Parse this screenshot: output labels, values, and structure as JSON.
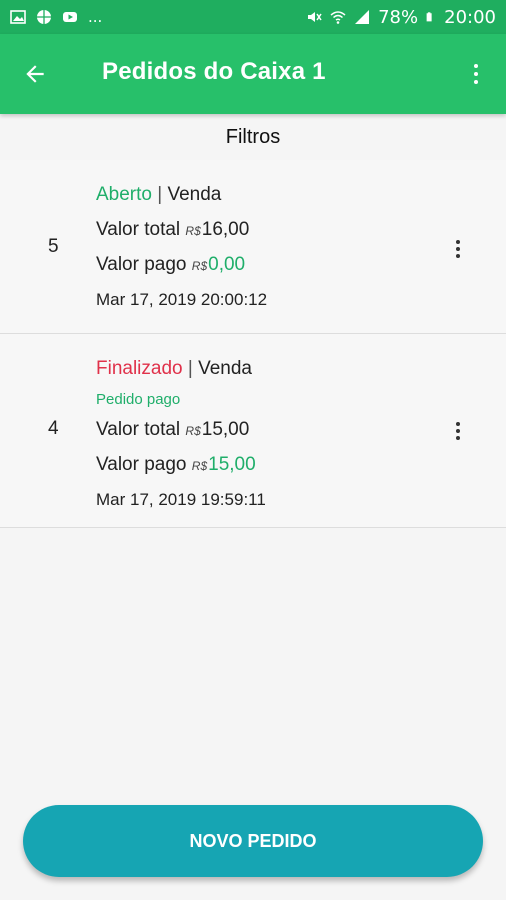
{
  "status_bar": {
    "left_text": "...",
    "battery": "78%",
    "time": "20:00",
    "icons": [
      "image-icon",
      "globe-icon",
      "youtube-icon",
      "mute-icon",
      "wifi-icon",
      "signal-icon",
      "battery-icon"
    ]
  },
  "app_bar": {
    "title": "Pedidos do Caixa 1",
    "color": "#27c06a"
  },
  "filters_label": "Filtros",
  "orders": [
    {
      "number": "5",
      "status": "Aberto",
      "separator": "|",
      "type": "Venda",
      "total_label": "Valor total",
      "currency": "R$",
      "total_value": "16,00",
      "paid_label": "Valor pago",
      "paid_value": "0,00",
      "date": "Mar 17, 2019 20:00:12"
    },
    {
      "number": "4",
      "status": "Finalizado",
      "separator": "|",
      "type": "Venda",
      "note": "Pedido pago",
      "total_label": "Valor total",
      "currency": "R$",
      "total_value": "15,00",
      "paid_label": "Valor pago",
      "paid_value": "15,00",
      "date": "Mar 17, 2019 19:59:11"
    }
  ],
  "fab": {
    "label": "NOVO PEDIDO",
    "color": "#16a5b3"
  },
  "colors": {
    "open": "#1fae6a",
    "finalized": "#e0314a"
  }
}
